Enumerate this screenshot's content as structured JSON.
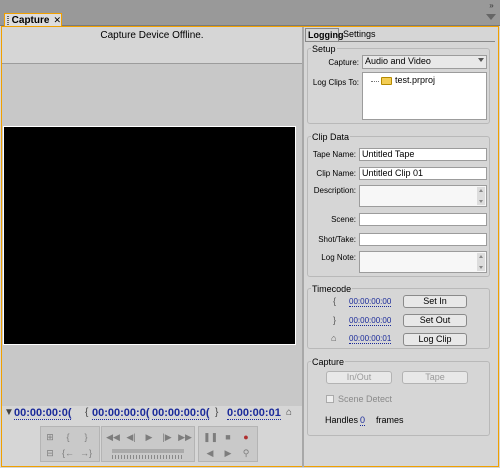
{
  "window": {
    "tab_label": "Capture",
    "tab_close": "✕",
    "panel_menu": "»"
  },
  "monitor": {
    "status": "Capture Device Offline.",
    "timecodes": {
      "current": "00:00:00:0(",
      "in": "00:00:00:0(",
      "out": "00:00:00:0(",
      "duration": "0:00:00:01"
    }
  },
  "right_tabs": [
    "Logging",
    "Settings"
  ],
  "setup": {
    "title": "Setup",
    "capture_label": "Capture:",
    "capture_value": "Audio and Video",
    "log_clips_label": "Log Clips To:",
    "log_clips_item": "test.prproj"
  },
  "clip_data": {
    "title": "Clip Data",
    "tape_name_label": "Tape Name:",
    "tape_name_value": "Untitled Tape",
    "clip_name_label": "Clip Name:",
    "clip_name_value": "Untitled Clip 01",
    "description_label": "Description:",
    "scene_label": "Scene:",
    "shot_label": "Shot/Take:",
    "log_note_label": "Log Note:"
  },
  "timecode": {
    "title": "Timecode",
    "in_value": "00:00:00:00",
    "out_value": "00:00:00:00",
    "dur_value": "00:00:00:01",
    "set_in": "Set In",
    "set_out": "Set Out",
    "log_clip": "Log Clip"
  },
  "capture": {
    "title": "Capture",
    "in_out": "In/Out",
    "tape": "Tape",
    "scene_detect": "Scene Detect",
    "handles_label": "Handles",
    "handles_value": "0",
    "frames_label": "frames"
  },
  "colors": {
    "accent": "#f0a000",
    "timecode_blue": "#1a2a9a",
    "video_bg": "#000000"
  }
}
